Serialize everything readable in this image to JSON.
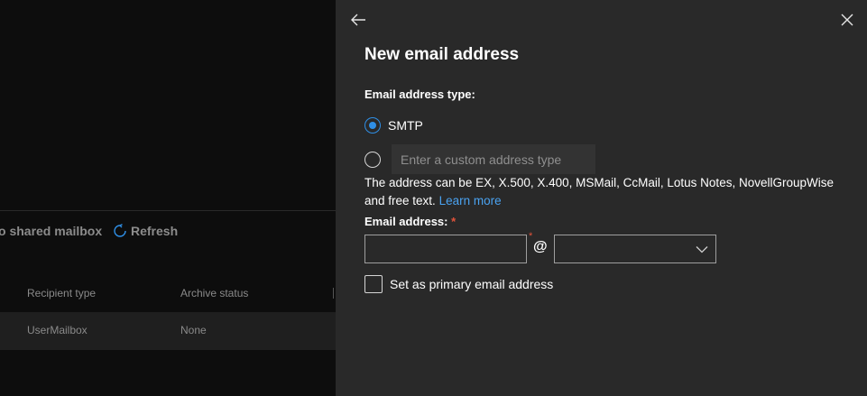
{
  "background": {
    "commands": {
      "convert_shared": "o shared mailbox",
      "refresh": "Refresh"
    },
    "columns": [
      "Recipient type",
      "Archive status"
    ],
    "row": [
      "UserMailbox",
      "None"
    ]
  },
  "panel": {
    "title": "New email address",
    "address_type_label": "Email address type:",
    "smtp_option": "SMTP",
    "custom_type_placeholder": "Enter a custom address type",
    "info_text": "The address can be EX, X.500, X.400, MSMail, CcMail, Lotus Notes, NovellGroupWise and free text.",
    "learn_more": "Learn more",
    "email_label": "Email address:",
    "required_mark": "*",
    "at_sign": "@",
    "email_local_value": "",
    "domain_value": "",
    "primary_checkbox_label": "Set as primary email address"
  },
  "colors": {
    "panel_bg": "#292929",
    "accent": "#2f8fe6",
    "link": "#4aa2f0",
    "required": "#e2533b"
  },
  "icons": {
    "back": "arrow-left-icon",
    "close": "close-icon",
    "refresh": "refresh-icon",
    "dropdown": "chevron-down-icon"
  }
}
